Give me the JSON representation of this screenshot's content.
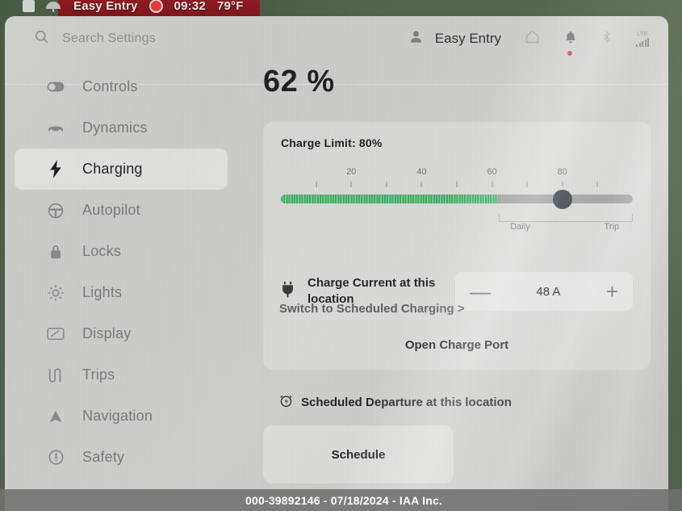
{
  "status_bar": {
    "square_icon": "app-square-icon",
    "umbrella_icon": "umbrella-icon",
    "profile_label": "Easy Entry",
    "record_icon": "record-icon",
    "time": "09:32",
    "temperature": "79°F"
  },
  "header": {
    "search_icon": "search-icon",
    "search_placeholder": "Search Settings",
    "profile_icon": "person-icon",
    "profile_name": "Easy Entry",
    "home_icon": "home-icon",
    "bell_icon": "bell-icon",
    "bluetooth_icon": "bluetooth-icon",
    "lte_label": "LTE",
    "signal_icon": "signal-bars-icon"
  },
  "sidebar": {
    "items": [
      {
        "label": "Controls",
        "icon": "toggle-icon",
        "active": false
      },
      {
        "label": "Dynamics",
        "icon": "car-icon",
        "active": false
      },
      {
        "label": "Charging",
        "icon": "lightning-bolt-icon",
        "active": true
      },
      {
        "label": "Autopilot",
        "icon": "steering-wheel-icon",
        "active": false
      },
      {
        "label": "Locks",
        "icon": "lock-icon",
        "active": false
      },
      {
        "label": "Lights",
        "icon": "sun-icon",
        "active": false
      },
      {
        "label": "Display",
        "icon": "display-icon",
        "active": false
      },
      {
        "label": "Trips",
        "icon": "route-icon",
        "active": false
      },
      {
        "label": "Navigation",
        "icon": "navigation-arrow-icon",
        "active": false
      },
      {
        "label": "Safety",
        "icon": "warning-circle-icon",
        "active": false
      }
    ]
  },
  "charging": {
    "battery_percent": "62 %",
    "charge_limit_text": "Charge Limit: 80%",
    "slider": {
      "value": 80,
      "battery_level": 62,
      "min": 0,
      "max": 100,
      "tick_labels": [
        "20",
        "40",
        "60",
        "80"
      ],
      "tick_values": [
        20,
        40,
        60,
        80
      ],
      "tick_marks": [
        10,
        20,
        30,
        40,
        50,
        60,
        70,
        80,
        90
      ],
      "range_start_label": "Daily",
      "range_end_label": "Trip",
      "range_start_value": 62,
      "range_end_value": 100,
      "fill_color": "#23bb52",
      "track_color": "#9b9c9c",
      "thumb_color": "#33383d"
    },
    "charge_current": {
      "plug_icon": "plug-icon",
      "label": "Charge Current at this location",
      "decrement": "—",
      "value": "48 A",
      "increment": "+"
    },
    "open_charge_port": "Open Charge Port",
    "scheduled_departure": {
      "icon": "scheduled-departure-icon",
      "title": "Scheduled Departure at this location",
      "button": "Schedule",
      "switch_link": "Switch to Scheduled Charging >"
    }
  },
  "watermark": {
    "text": "000-39892146 - 07/18/2024 - IAA Inc."
  }
}
